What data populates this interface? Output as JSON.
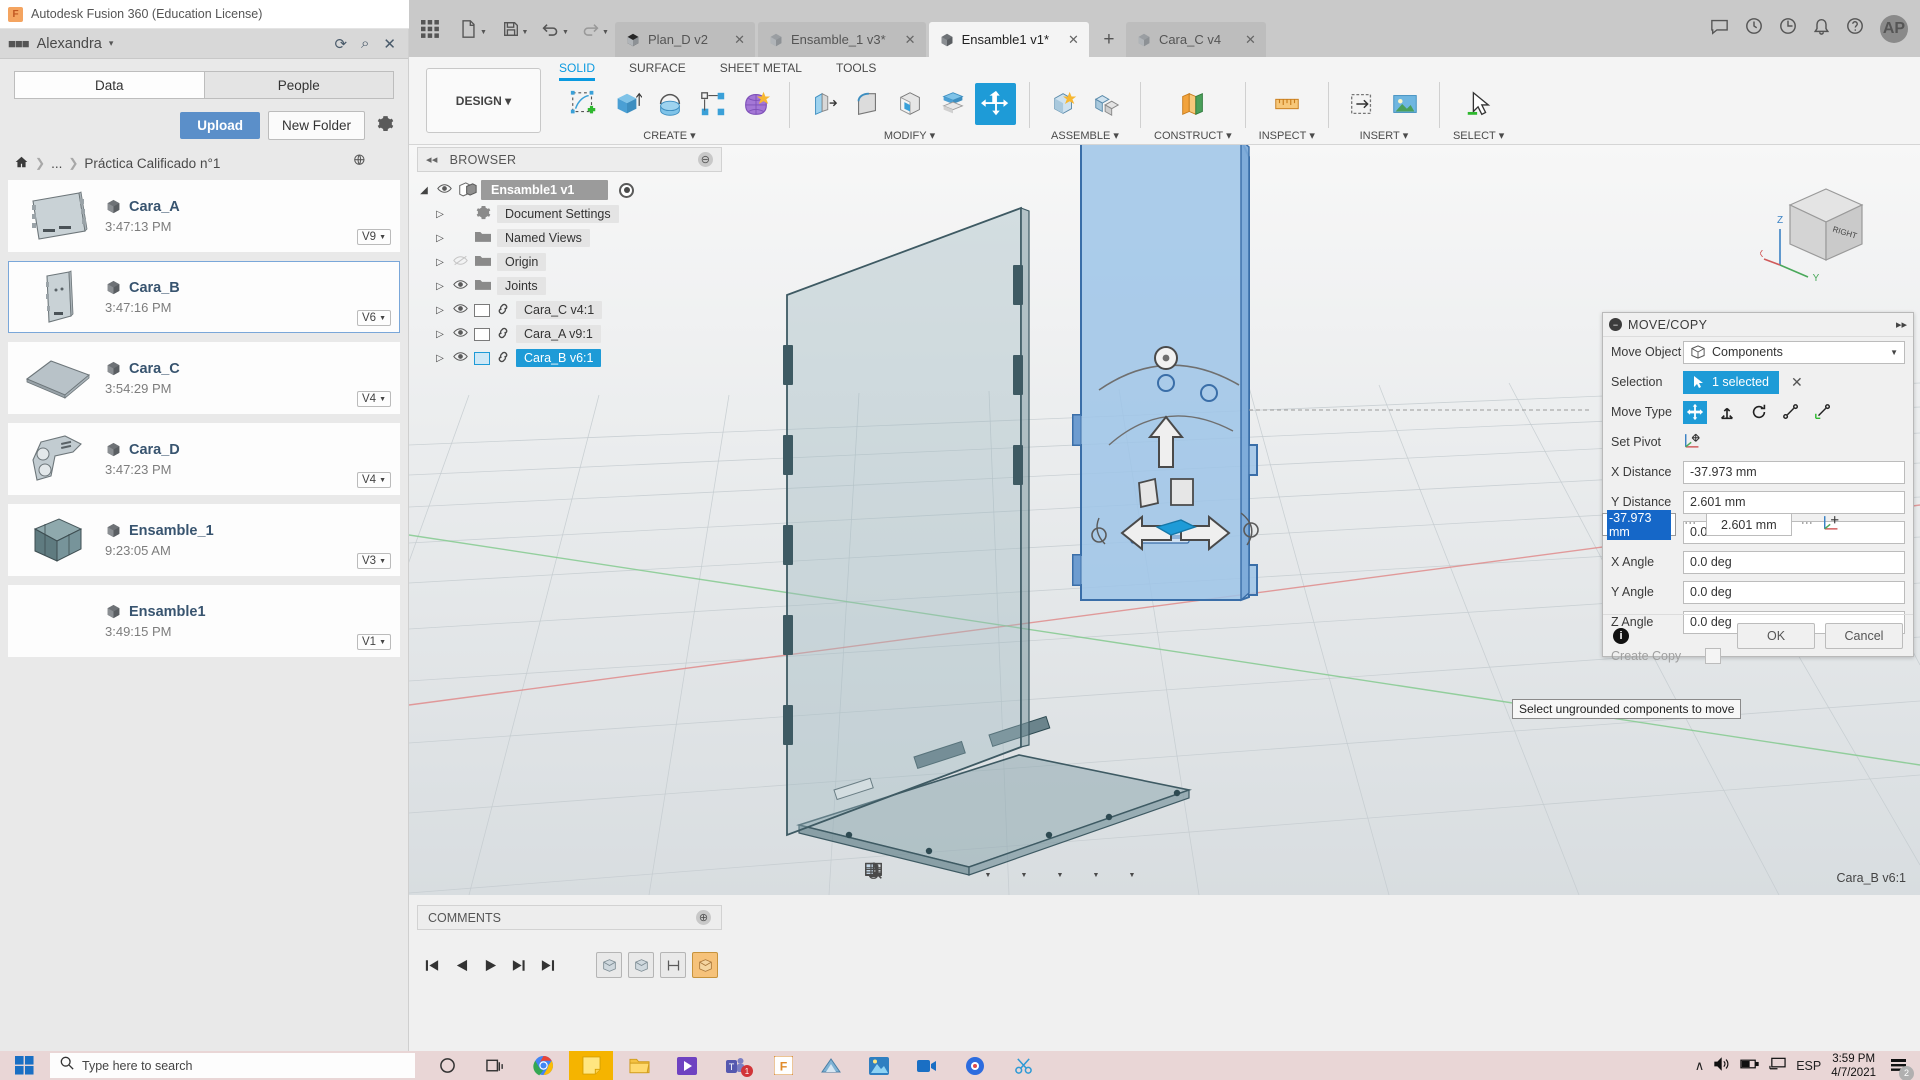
{
  "window": {
    "title": "Autodesk Fusion 360 (Education License)",
    "minimize": "–",
    "maximize": "□",
    "close": "✕"
  },
  "data_panel": {
    "user": "Alexandra",
    "user_caret": "▾",
    "refresh_icon": "⟳",
    "search_icon": "⌕",
    "close_icon": "✕",
    "tabs": [
      {
        "label": "Data",
        "active": true
      },
      {
        "label": "People",
        "active": false
      }
    ],
    "upload_label": "Upload",
    "new_folder_label": "New Folder",
    "breadcrumb": {
      "home": "⌂",
      "ellipsis": "...",
      "current": "Práctica Calificado n°1"
    },
    "files": [
      {
        "name": "Cara_A",
        "time": "3:47:13 PM",
        "version": "V9",
        "selected": false,
        "thumb": "plate-a"
      },
      {
        "name": "Cara_B",
        "time": "3:47:16 PM",
        "version": "V6",
        "selected": true,
        "thumb": "plate-b"
      },
      {
        "name": "Cara_C",
        "time": "3:54:29 PM",
        "version": "V4",
        "selected": false,
        "thumb": "plate-c"
      },
      {
        "name": "Cara_D",
        "time": "3:47:23 PM",
        "version": "V4",
        "selected": false,
        "thumb": "plate-d"
      },
      {
        "name": "Ensamble_1",
        "time": "9:23:05 AM",
        "version": "V3",
        "selected": false,
        "thumb": "assembly"
      },
      {
        "name": "Ensamble1",
        "time": "3:49:15 PM",
        "version": "V1",
        "selected": false,
        "thumb": "none"
      }
    ]
  },
  "tabstrip": {
    "doc_tabs": [
      {
        "label": "Plan_D v2",
        "active": false
      },
      {
        "label": "Ensamble_1 v3*",
        "active": false
      },
      {
        "label": "Ensamble1 v1*",
        "active": true
      },
      {
        "label": "Cara_C v4",
        "active": false
      }
    ],
    "plus": "+",
    "close": "✕",
    "avatar_initials": "AP"
  },
  "ribbon": {
    "design_label": "DESIGN",
    "design_caret": "▾",
    "tabs": [
      {
        "label": "SOLID",
        "active": true
      },
      {
        "label": "SURFACE",
        "active": false
      },
      {
        "label": "SHEET METAL",
        "active": false
      },
      {
        "label": "TOOLS",
        "active": false
      }
    ],
    "groups": [
      {
        "label": "CREATE",
        "caret": "▾",
        "icon_count": 5
      },
      {
        "label": "MODIFY",
        "caret": "▾",
        "icon_count": 5
      },
      {
        "label": "ASSEMBLE",
        "caret": "▾",
        "icon_count": 2
      },
      {
        "label": "CONSTRUCT",
        "caret": "▾",
        "icon_count": 1
      },
      {
        "label": "INSPECT",
        "caret": "▾",
        "icon_count": 1
      },
      {
        "label": "INSERT",
        "caret": "▾",
        "icon_count": 2
      },
      {
        "label": "SELECT",
        "caret": "▾",
        "icon_count": 1
      }
    ]
  },
  "browser": {
    "title": "BROWSER",
    "collapse_icon": "◂◂",
    "circle_icon": "⊖",
    "root": {
      "label": "Ensamble1 v1"
    },
    "items": [
      {
        "label": "Document Settings",
        "icon": "gear",
        "eye": "none",
        "indent": 1
      },
      {
        "label": "Named Views",
        "icon": "folder",
        "eye": "none",
        "indent": 1
      },
      {
        "label": "Origin",
        "icon": "folder",
        "eye": "hidden",
        "indent": 1
      },
      {
        "label": "Joints",
        "icon": "folder",
        "eye": "visible",
        "indent": 1
      }
    ],
    "components": [
      {
        "label": "Cara_C v4:1",
        "selected": false
      },
      {
        "label": "Cara_A v9:1",
        "selected": false
      },
      {
        "label": "Cara_B v6:1",
        "selected": true
      }
    ]
  },
  "canvas": {
    "viewcube_labels": {
      "top": "Z",
      "right": "Y",
      "left": "X",
      "face": "RIGHT"
    },
    "status_component": "Cara_B v6:1",
    "comments_title": "COMMENTS",
    "comments_circle": "⊕"
  },
  "move_copy": {
    "title": "MOVE/COPY",
    "minus_icon": "−",
    "expand_icon": "▸▸",
    "move_object_label": "Move Object",
    "move_object_value": "Components",
    "selection_label": "Selection",
    "selection_value": "1 selected",
    "clear_icon": "✕",
    "move_type_label": "Move Type",
    "set_pivot_label": "Set Pivot",
    "fields": [
      {
        "label": "X Distance",
        "value": "-37.973 mm"
      },
      {
        "label": "Y Distance",
        "value": "2.601 mm"
      },
      {
        "label": "Z Distance",
        "value": "0.00 mm"
      },
      {
        "label": "X Angle",
        "value": "0.0 deg"
      },
      {
        "label": "Y Angle",
        "value": "0.0 deg"
      },
      {
        "label": "Z Angle",
        "value": "0.0 deg"
      }
    ],
    "edit_overlay": {
      "editing_value": "-37.973 mm",
      "neighbor_value": "2.601 mm"
    },
    "create_copy_label": "Create Copy",
    "info_icon": "i",
    "ok_label": "OK",
    "cancel_label": "Cancel",
    "tooltip": "Select ungrounded components to move",
    "accent_color": "#1e9bd7"
  },
  "taskbar": {
    "search_placeholder": "Type here to search",
    "search_icon": "⌕",
    "language": "ESP",
    "time": "3:59 PM",
    "date": "4/7/2021",
    "notification_count": "2",
    "chevron_up": "∧",
    "volume_icon": "🔊",
    "battery_icon": "▮",
    "network_icon": "⎕"
  }
}
